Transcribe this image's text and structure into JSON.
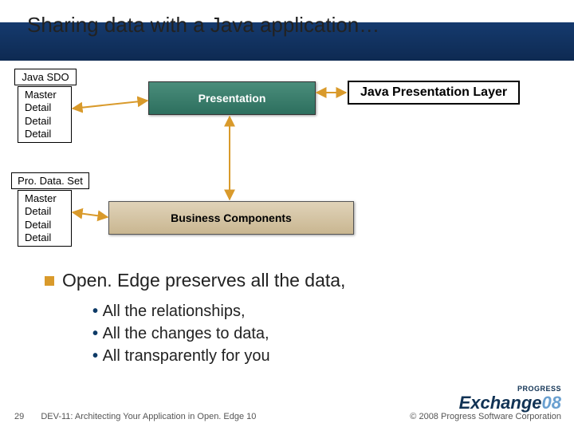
{
  "title": "Sharing data with a Java application…",
  "sdo": {
    "label": "Java SDO",
    "rows": [
      "Master",
      " Detail",
      " Detail",
      " Detail"
    ]
  },
  "pds": {
    "label": "Pro. Data. Set",
    "rows": [
      "Master",
      " Detail",
      " Detail",
      " Detail"
    ]
  },
  "boxes": {
    "presentation": "Presentation",
    "business": "Business Components",
    "jpl": "Java Presentation Layer"
  },
  "bullets": {
    "main": "Open. Edge preserves all the data,",
    "subs": [
      "All the relationships,",
      "All the changes to data,",
      "All transparently for you"
    ]
  },
  "footer": {
    "page": "29",
    "session": "DEV-11: Architecting Your Application in Open. Edge 10",
    "copyright": "© 2008 Progress Software Corporation"
  },
  "logo": {
    "top": "PROGRESS",
    "main_a": "Exchange",
    "main_b": "08"
  }
}
